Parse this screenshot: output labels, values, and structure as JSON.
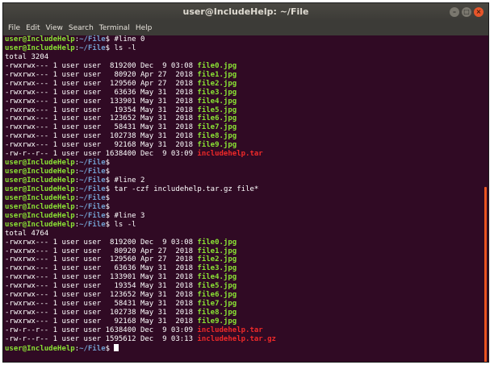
{
  "window": {
    "title": "user@IncludeHelp: ~/File",
    "buttons": {
      "minimize": "–",
      "maximize": "□",
      "close": "×"
    }
  },
  "menu": [
    "File",
    "Edit",
    "View",
    "Search",
    "Terminal",
    "Help"
  ],
  "prompt": {
    "user": "user@IncludeHelp",
    "sep": ":",
    "path": "~/File",
    "sym": "$"
  },
  "colors": {
    "background": "#300a24",
    "prompt_user": "#8ae234",
    "prompt_path": "#729fcf",
    "file_jpg": "#8ae234",
    "file_archive": "#ef2929"
  },
  "lines": [
    {
      "type": "prompt",
      "cmd": " #line 0"
    },
    {
      "type": "prompt",
      "cmd": " ls -l"
    },
    {
      "type": "text",
      "text": "total 3204"
    },
    {
      "type": "file",
      "meta": "-rwxrwx--- 1 user user  819200 Dec  9 03:08 ",
      "name": "file0.jpg",
      "kind": "img"
    },
    {
      "type": "file",
      "meta": "-rwxrwx--- 1 user user   80920 Apr 27  2018 ",
      "name": "file1.jpg",
      "kind": "img"
    },
    {
      "type": "file",
      "meta": "-rwxrwx--- 1 user user  129560 Apr 27  2018 ",
      "name": "file2.jpg",
      "kind": "img"
    },
    {
      "type": "file",
      "meta": "-rwxrwx--- 1 user user   63636 May 31  2018 ",
      "name": "file3.jpg",
      "kind": "img"
    },
    {
      "type": "file",
      "meta": "-rwxrwx--- 1 user user  133901 May 31  2018 ",
      "name": "file4.jpg",
      "kind": "img"
    },
    {
      "type": "file",
      "meta": "-rwxrwx--- 1 user user   19354 May 31  2018 ",
      "name": "file5.jpg",
      "kind": "img"
    },
    {
      "type": "file",
      "meta": "-rwxrwx--- 1 user user  123652 May 31  2018 ",
      "name": "file6.jpg",
      "kind": "img"
    },
    {
      "type": "file",
      "meta": "-rwxrwx--- 1 user user   58431 May 31  2018 ",
      "name": "file7.jpg",
      "kind": "img"
    },
    {
      "type": "file",
      "meta": "-rwxrwx--- 1 user user  102738 May 31  2018 ",
      "name": "file8.jpg",
      "kind": "img"
    },
    {
      "type": "file",
      "meta": "-rwxrwx--- 1 user user   92168 May 31  2018 ",
      "name": "file9.jpg",
      "kind": "img"
    },
    {
      "type": "file",
      "meta": "-rw-r--r-- 1 user user 1638400 Dec  9 03:09 ",
      "name": "includehelp.tar",
      "kind": "archive"
    },
    {
      "type": "prompt",
      "cmd": ""
    },
    {
      "type": "prompt",
      "cmd": ""
    },
    {
      "type": "prompt",
      "cmd": " #line 2"
    },
    {
      "type": "prompt",
      "cmd": " tar -czf includehelp.tar.gz file*"
    },
    {
      "type": "prompt",
      "cmd": ""
    },
    {
      "type": "prompt",
      "cmd": ""
    },
    {
      "type": "prompt",
      "cmd": " #line 3"
    },
    {
      "type": "prompt",
      "cmd": " ls -l"
    },
    {
      "type": "text",
      "text": "total 4764"
    },
    {
      "type": "file",
      "meta": "-rwxrwx--- 1 user user  819200 Dec  9 03:08 ",
      "name": "file0.jpg",
      "kind": "img"
    },
    {
      "type": "file",
      "meta": "-rwxrwx--- 1 user user   80920 Apr 27  2018 ",
      "name": "file1.jpg",
      "kind": "img"
    },
    {
      "type": "file",
      "meta": "-rwxrwx--- 1 user user  129560 Apr 27  2018 ",
      "name": "file2.jpg",
      "kind": "img"
    },
    {
      "type": "file",
      "meta": "-rwxrwx--- 1 user user   63636 May 31  2018 ",
      "name": "file3.jpg",
      "kind": "img"
    },
    {
      "type": "file",
      "meta": "-rwxrwx--- 1 user user  133901 May 31  2018 ",
      "name": "file4.jpg",
      "kind": "img"
    },
    {
      "type": "file",
      "meta": "-rwxrwx--- 1 user user   19354 May 31  2018 ",
      "name": "file5.jpg",
      "kind": "img"
    },
    {
      "type": "file",
      "meta": "-rwxrwx--- 1 user user  123652 May 31  2018 ",
      "name": "file6.jpg",
      "kind": "img"
    },
    {
      "type": "file",
      "meta": "-rwxrwx--- 1 user user   58431 May 31  2018 ",
      "name": "file7.jpg",
      "kind": "img"
    },
    {
      "type": "file",
      "meta": "-rwxrwx--- 1 user user  102738 May 31  2018 ",
      "name": "file8.jpg",
      "kind": "img"
    },
    {
      "type": "file",
      "meta": "-rwxrwx--- 1 user user   92168 May 31  2018 ",
      "name": "file9.jpg",
      "kind": "img"
    },
    {
      "type": "file",
      "meta": "-rw-r--r-- 1 user user 1638400 Dec  9 03:09 ",
      "name": "includehelp.tar",
      "kind": "archive"
    },
    {
      "type": "file",
      "meta": "-rw-r--r-- 1 user user 1595612 Dec  9 03:13 ",
      "name": "includehelp.tar.gz",
      "kind": "archive"
    },
    {
      "type": "prompt",
      "cmd": " ",
      "cursor": true
    }
  ]
}
